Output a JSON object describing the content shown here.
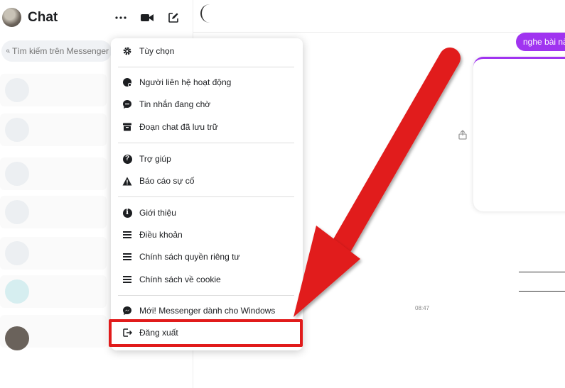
{
  "sidebar": {
    "title": "Chat",
    "search_placeholder": "Tìm kiếm trên Messenger"
  },
  "menu": {
    "items": [
      {
        "label": "Tùy chọn",
        "icon": "gear-icon"
      },
      {
        "label": "Người liên hệ hoạt động",
        "icon": "active-contacts-icon"
      },
      {
        "label": "Tin nhắn đang chờ",
        "icon": "message-bubble-icon"
      },
      {
        "label": "Đoạn chat đã lưu trữ",
        "icon": "archive-icon"
      },
      {
        "label": "Trợ giúp",
        "icon": "help-icon"
      },
      {
        "label": "Báo cáo sự cố",
        "icon": "warning-icon"
      },
      {
        "label": "Giới thiệu",
        "icon": "info-icon"
      },
      {
        "label": "Điều khoản",
        "icon": "document-lines-icon"
      },
      {
        "label": "Chính sách quyền riêng tư",
        "icon": "document-lines-icon"
      },
      {
        "label": "Chính sách về cookie",
        "icon": "document-lines-icon"
      },
      {
        "label": "Mới! Messenger dành cho Windows",
        "icon": "messenger-icon"
      },
      {
        "label": "Đăng xuất",
        "icon": "logout-icon"
      }
    ]
  },
  "chat": {
    "outgoing_message": "nghe bài nà",
    "timestamp": "08:47"
  },
  "colors": {
    "accent": "#a034f0",
    "highlight": "#e11b1b"
  }
}
